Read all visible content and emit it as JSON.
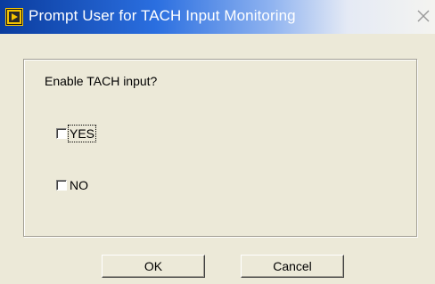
{
  "window": {
    "title": "Prompt User for TACH Input Monitoring",
    "icon": "labview-app-icon",
    "close_icon": "close-icon"
  },
  "prompt": {
    "question": "Enable TACH input?"
  },
  "options": [
    {
      "label": "YES",
      "checked": false,
      "focused": true
    },
    {
      "label": "NO",
      "checked": false,
      "focused": false
    }
  ],
  "buttons": {
    "ok_label": "OK",
    "cancel_label": "Cancel"
  },
  "colors": {
    "title_gradient_start": "#0a3c9e",
    "title_gradient_mid": "#2b6fe0",
    "dialog_background": "#ece9d8",
    "icon_accent": "#f5c400"
  }
}
